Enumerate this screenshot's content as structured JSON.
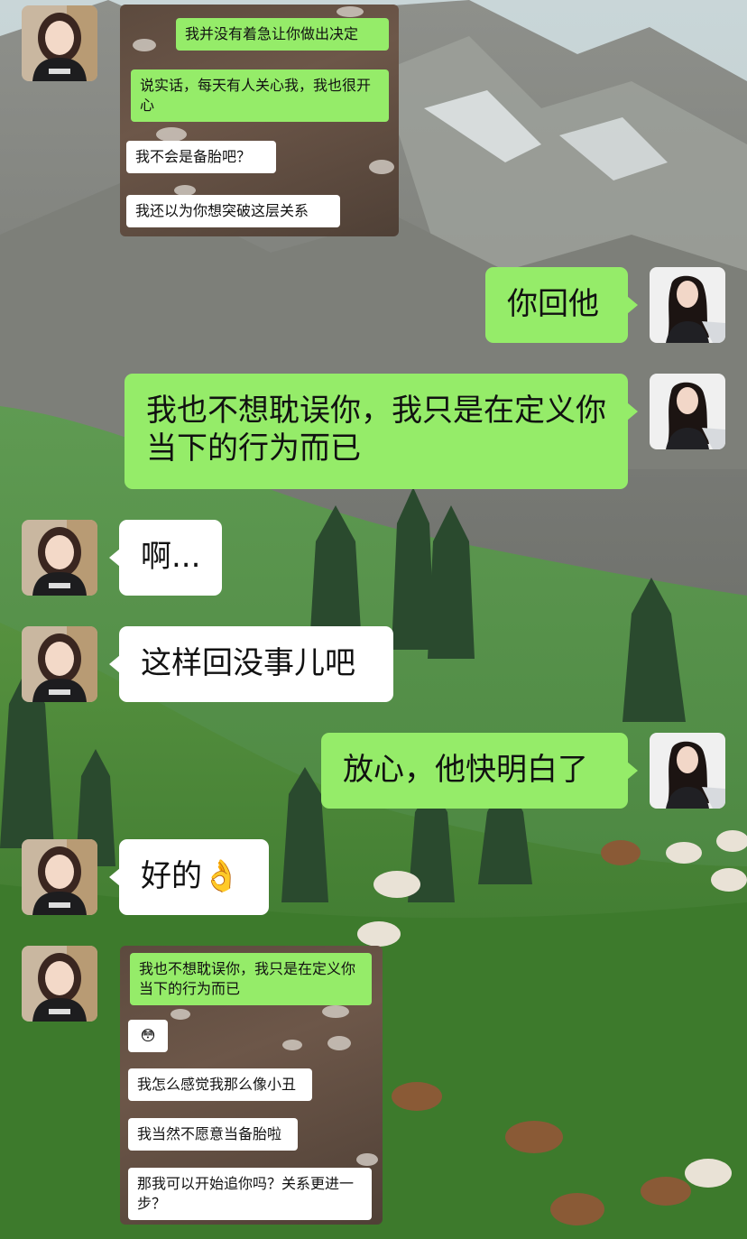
{
  "top_screenshot": {
    "messages": [
      {
        "side": "right",
        "text": "我并没有着急让你做出决定"
      },
      {
        "side": "right",
        "text": "说实话，每天有人关心我，我也很开心"
      },
      {
        "side": "left",
        "text": "我不会是备胎吧？"
      },
      {
        "side": "left",
        "text": "我还以为你想突破这层关系"
      }
    ]
  },
  "chat": [
    {
      "side": "right",
      "text": "你回他"
    },
    {
      "side": "right",
      "text": "我也不想耽误你，我只是在定义你当下的行为而已"
    },
    {
      "side": "left",
      "text": "啊..."
    },
    {
      "side": "left",
      "text": "这样回没事儿吧"
    },
    {
      "side": "right",
      "text": "放心，他快明白了"
    },
    {
      "side": "left",
      "text": "好的👌"
    }
  ],
  "bottom_screenshot": {
    "messages": [
      {
        "side": "right",
        "text": "我也不想耽误你，我只是在定义你当下的行为而已"
      },
      {
        "side": "left",
        "text": "😳"
      },
      {
        "side": "left",
        "text": "我怎么感觉我那么像小丑"
      },
      {
        "side": "left",
        "text": "我当然不愿意当备胎啦"
      },
      {
        "side": "left",
        "text": "那我可以开始追你吗？关系更进一步？"
      }
    ]
  },
  "colors": {
    "self_bubble": "#95ec69",
    "other_bubble": "#ffffff"
  },
  "icons": {
    "contact_avatar": "girl-portrait-avatar",
    "self_avatar": "woman-long-hair-avatar"
  }
}
